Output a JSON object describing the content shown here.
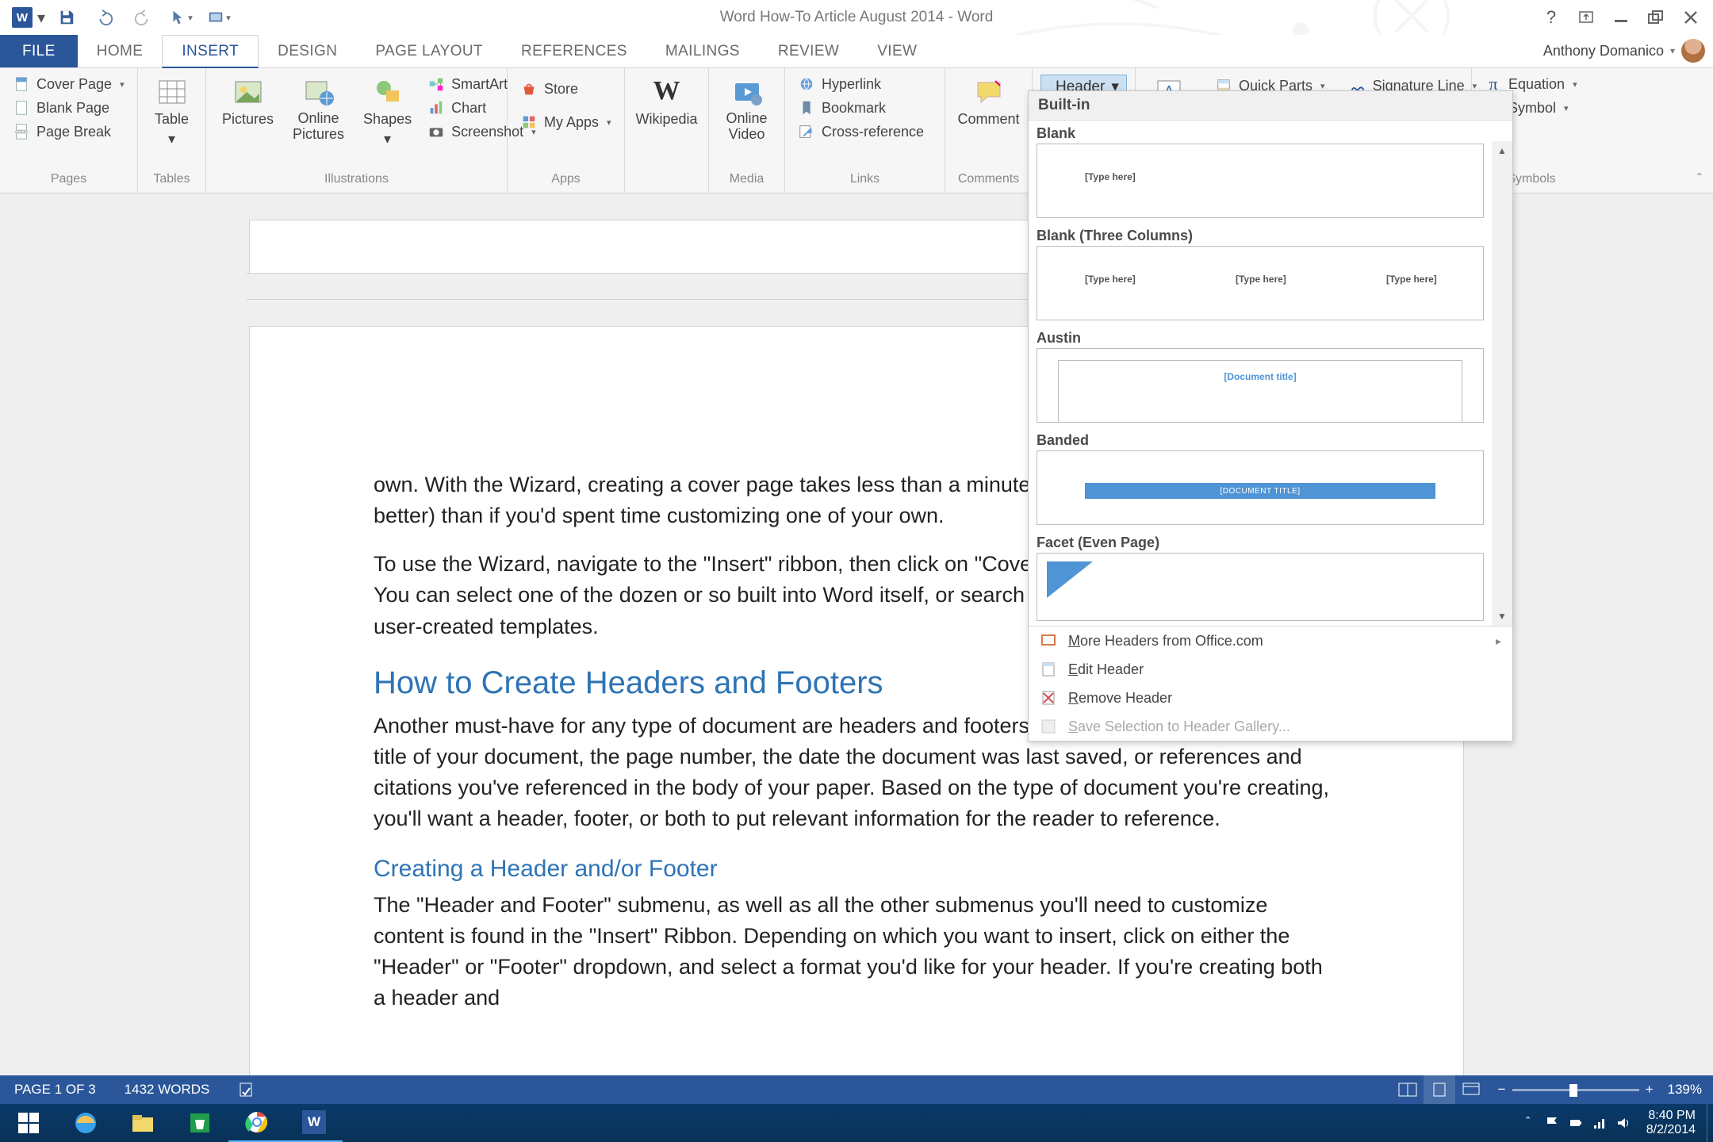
{
  "title": "Word How-To Article August 2014 - Word",
  "account": "Anthony Domanico",
  "tabs": [
    "FILE",
    "HOME",
    "INSERT",
    "DESIGN",
    "PAGE LAYOUT",
    "REFERENCES",
    "MAILINGS",
    "REVIEW",
    "VIEW"
  ],
  "active_tab": 2,
  "ribbon": {
    "pages": {
      "label": "Pages",
      "cover": "Cover Page",
      "blank": "Blank Page",
      "break": "Page Break"
    },
    "tables": {
      "label": "Tables",
      "table": "Table"
    },
    "illus": {
      "label": "Illustrations",
      "pictures": "Pictures",
      "online_pic": "Online Pictures",
      "shapes": "Shapes",
      "smartart": "SmartArt",
      "chart": "Chart",
      "screenshot": "Screenshot"
    },
    "apps": {
      "label": "Apps",
      "store": "Store",
      "myapps": "My Apps"
    },
    "wiki": {
      "label": "",
      "wikipedia": "Wikipedia"
    },
    "media": {
      "label": "Media",
      "video": "Online Video"
    },
    "links": {
      "label": "Links",
      "hyper": "Hyperlink",
      "book": "Bookmark",
      "cross": "Cross-reference"
    },
    "comments": {
      "label": "Comments",
      "comment": "Comment"
    },
    "hf": {
      "header": "Header"
    },
    "text": {
      "label": "",
      "quick": "Quick Parts",
      "sig": "Signature Line"
    },
    "symbols": {
      "label": "Symbols",
      "eq": "Equation",
      "sym": "Symbol"
    }
  },
  "gallery": {
    "category": "Built-in",
    "items": [
      {
        "name": "Blank",
        "ph": [
          "[Type here]"
        ]
      },
      {
        "name": "Blank (Three Columns)",
        "ph": [
          "[Type here]",
          "[Type here]",
          "[Type here]"
        ]
      },
      {
        "name": "Austin",
        "ph": [
          "[Document title]"
        ]
      },
      {
        "name": "Banded",
        "ph": [
          "[DOCUMENT TITLE]"
        ]
      },
      {
        "name": "Facet (Even Page)",
        "ph": []
      }
    ],
    "footer": {
      "more": "More Headers from Office.com",
      "edit": "Edit Header",
      "remove": "Remove Header",
      "save": "Save Selection to Header Gallery..."
    },
    "hot": {
      "more": "M",
      "edit": "E",
      "remove": "R",
      "save": "S"
    }
  },
  "doc": {
    "p1": "own. With the Wizard, creating a cover page takes less than a minute, and can look as good (or even better) than if you'd spent time customizing one of your own.",
    "p2": "To use the Wizard, navigate to the \"Insert\" ribbon, then click on \"Cover Page\" and select a template. You can select one of the dozen or so built into Word itself, or search through Microsoft's library and user-created templates.",
    "h2": "How to Create Headers and Footers",
    "p3": "Another must-have for any type of document are headers and footers. Use these to communicate the title of your document, the page number, the date the document was last saved, or references and citations you've referenced in the body of your paper. Based on the type of document you're creating, you'll want a header, footer, or both to put relevant information for the reader to reference.",
    "h3": "Creating a Header and/or Footer",
    "p4": "The \"Header and Footer\" submenu, as well as all the other submenus you'll need to customize content is found in the \"Insert\" Ribbon. Depending on which you want to insert, click on either the \"Header\" or \"Footer\" dropdown, and select a format you'd like for your header. If you're creating both a header and"
  },
  "status": {
    "page": "PAGE 1 OF 3",
    "words": "1432 WORDS",
    "zoom": "139%"
  },
  "clock": {
    "time": "8:40 PM",
    "date": "8/2/2014"
  }
}
